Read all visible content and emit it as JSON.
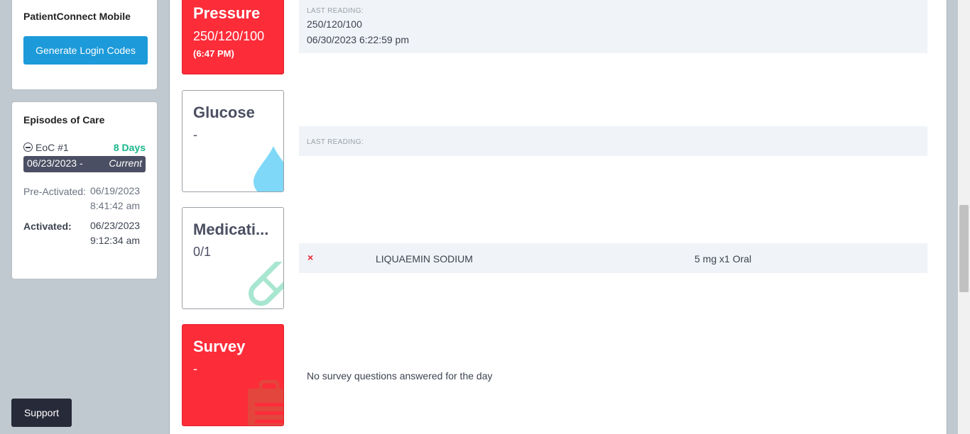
{
  "sidebar": {
    "mobile_card": {
      "title": "PatientConnect Mobile",
      "button_label": "Generate Login Codes"
    },
    "episodes_card": {
      "title": "Episodes of Care",
      "eoc_label": "EoC #1",
      "eoc_duration": "8 Days",
      "date_range_start": "06/23/2023 -",
      "date_range_status": "Current",
      "pre_activated_label": "Pre-Activated:",
      "pre_activated_date": "06/19/2023",
      "pre_activated_time": "8:41:42 am",
      "activated_label": "Activated:",
      "activated_date": "06/23/2023",
      "activated_time": "9:12:34 am"
    },
    "support_label": "Support"
  },
  "tiles": {
    "pressure": {
      "title": "Pressure",
      "value": "250/120/100",
      "time": "(6:47 PM)",
      "last_reading_label": "LAST READING:",
      "last_reading_value": "250/120/100",
      "last_reading_datetime": "06/30/2023 6:22:59 pm"
    },
    "glucose": {
      "title": "Glucose",
      "value": "-",
      "last_reading_label": "LAST READING:"
    },
    "medication": {
      "title": "Medicati...",
      "value": "0/1",
      "row": {
        "status_icon": "x-icon",
        "name": "LIQUAEMIN SODIUM",
        "dose": "5 mg x1 Oral"
      }
    },
    "survey": {
      "title": "Survey",
      "value": "-",
      "message": "No survey questions answered for the day"
    }
  },
  "colors": {
    "alert_red": "#fd2c39",
    "primary_blue": "#1c9ad9",
    "success_green": "#19b78a",
    "dark_pill": "#4b4f63",
    "glucose_drop": "#7fd8f7",
    "pill_mint": "#a8e6d0"
  },
  "icons": [
    "minus-circle-icon",
    "x-icon",
    "drop-icon",
    "pill-icon",
    "clipboard-icon"
  ]
}
